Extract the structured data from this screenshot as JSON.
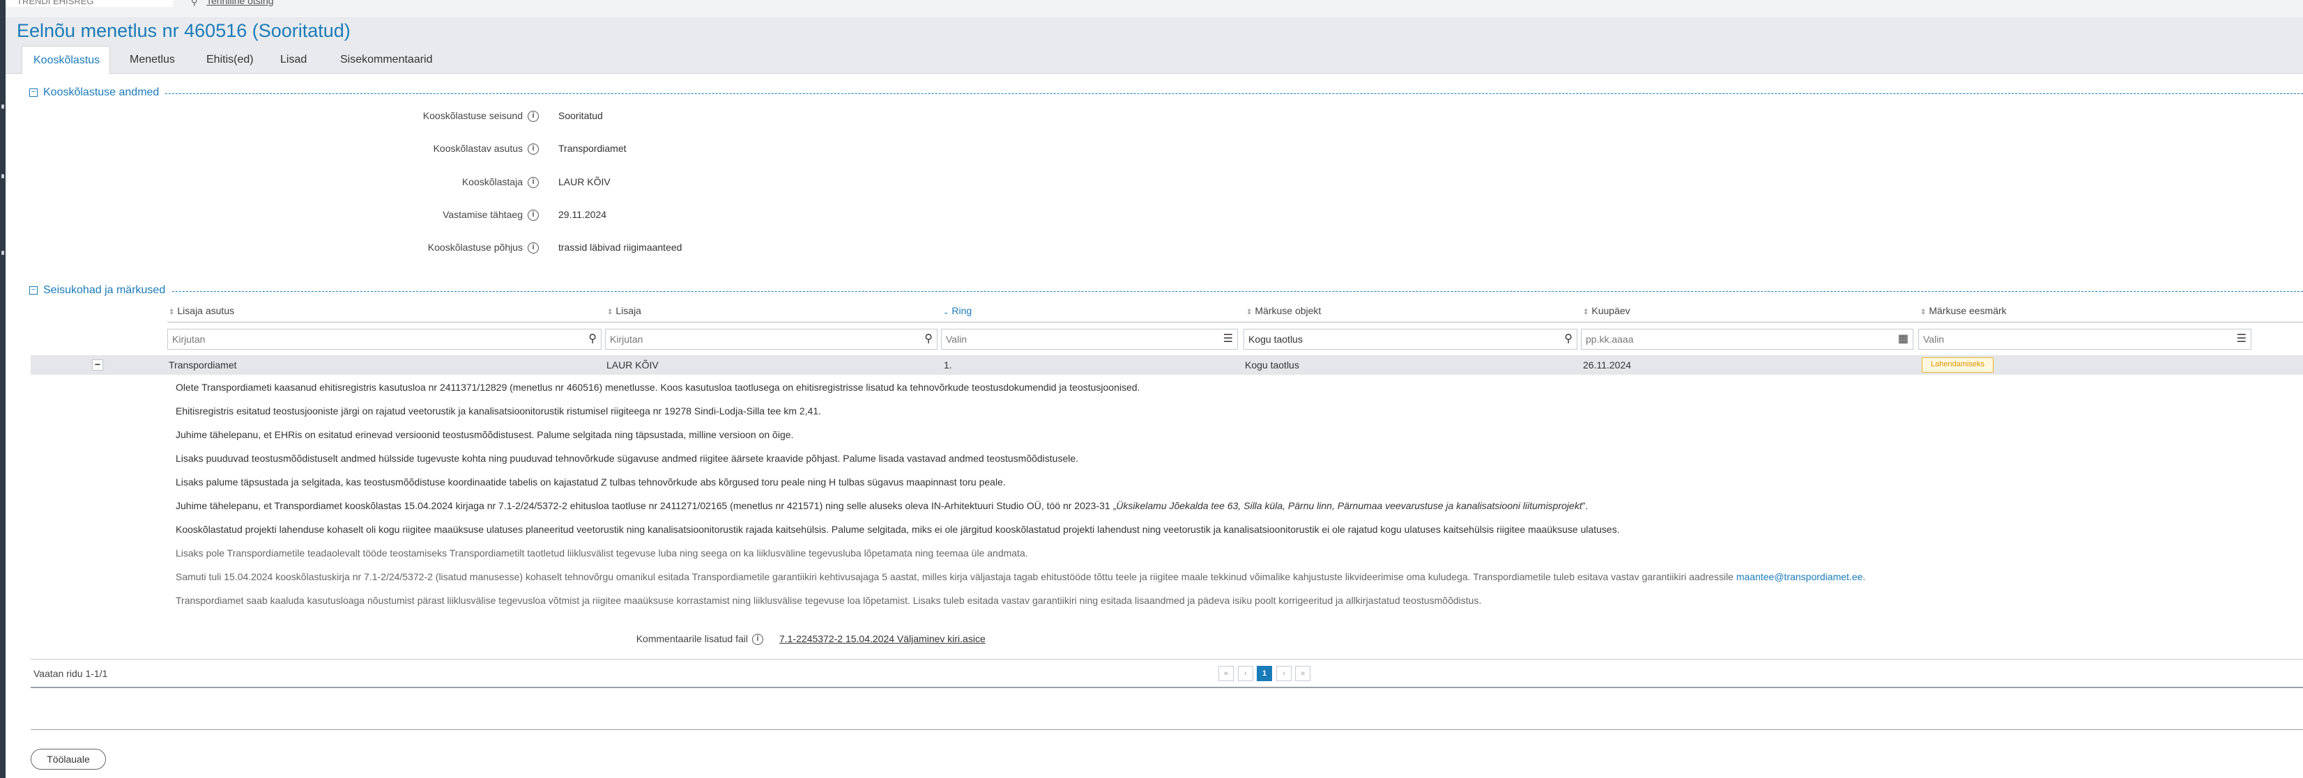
{
  "topbar": {
    "app_tab": "TRENDI EHISREG",
    "link": "Tehniline otsing"
  },
  "page": {
    "title": "Eelnõu menetlus nr 460516 (Sooritatud)"
  },
  "tabs": [
    "Kooskõlastus",
    "Menetlus",
    "Ehitis(ed)",
    "Lisad",
    "Sisekommentaarid"
  ],
  "sections": {
    "details": "Kooskõlastuse andmed",
    "remarks": "Seisukohad ja märkused"
  },
  "details": [
    {
      "label": "Kooskõlastuse seisund",
      "value": "Sooritatud"
    },
    {
      "label": "Kooskõlastav asutus",
      "value": "Transpordiamet"
    },
    {
      "label": "Kooskõlastaja",
      "value": "LAUR KÕIV"
    },
    {
      "label": "Vastamise tähtaeg",
      "value": "29.11.2024"
    },
    {
      "label": "Kooskõlastuse põhjus",
      "value": "trassid läbivad riigimaanteed"
    }
  ],
  "table": {
    "columns": [
      "Lisaja asutus",
      "Lisaja",
      "Ring",
      "Märkuse objekt",
      "Kuupäev",
      "Märkuse eesmärk"
    ],
    "filters": [
      "Kirjutan",
      "Kirjutan",
      "Valin",
      "Kogu taotlus",
      "pp.kk.aaaa",
      "Valin"
    ],
    "row": {
      "org": "Transpordiamet",
      "author": "LAUR KÕIV",
      "round": "1.",
      "object": "Kogu taotlus",
      "date": "26.11.2024",
      "purpose": "Lahendamiseks"
    },
    "remarks": [
      "Olete Transpordiameti kaasanud ehitisregistris kasutusloa nr 2411371/12829 (menetlus nr 460516) menetlusse. Koos kasutusloa taotlusega on ehitisregistrisse lisatud ka tehnovõrkude teostusdokumendid ja teostusjoonised.",
      "Ehitisregistris esitatud teostusjooniste järgi on rajatud veetorustik ja kanalisatsioonitorustik ristumisel riigiteega nr 19278 Sindi-Lodja-Silla tee km 2,41.",
      "Juhime tähelepanu, et EHRis on esitatud erinevad versioonid teostusmõõdistusest. Palume selgitada ning täpsustada, milline versioon on õige.",
      "Lisaks puuduvad teostusmõõdistuselt andmed hülsside tugevuste kohta ning puuduvad tehnovõrkude sügavuse andmed riigitee äärsete kraavide põhjast. Palume lisada vastavad andmed teostusmõõdistusele.",
      "Lisaks palume täpsustada ja selgitada, kas teostusmõõdistuse koordinaatide tabelis on kajastatud Z tulbas tehnovõrkude abs kõrgused toru peale ning H tulbas sügavus maapinnast toru peale.",
      "Juhime tähelepanu, et Transpordiamet kooskõlastas 15.04.2024 kirjaga nr 7.1-2/24/5372-2 ehitusloa taotluse nr 2411271/02165  (menetlus nr 421571) ning selle aluseks oleva IN-Arhitektuuri Studio OÜ, töö nr  2023-31 „",
      "Üksikelamu Jõekalda tee 63, Silla küla, Pärnu linn, Pärnumaa veevarustuse ja kanalisatsiooni liitumisprojekt",
      "”.",
      "Kooskõlastatud projekti lahenduse kohaselt oli kogu riigitee maaüksuse ulatuses planeeritud veetorustik ning kanalisatsioonitorustik rajada kaitsehülsis. Palume selgitada, miks ei ole järgitud kooskõlastatud projekti lahendust ning veetorustik ja kanalisatsioonitorustik ei ole rajatud kogu ulatuses kaitsehülsis riigitee maaüksuse ulatuses.",
      "Lisaks pole Transpordiametile teadaolevalt tööde teostamiseks Transpordiametilt taotletud liiklusvälist tegevuse luba ning seega on ka liiklusväline tegevusluba lõpetamata ning teemaa üle andmata.",
      "Samuti tuli 15.04.2024 kooskõlastuskirja nr 7.1-2/24/5372-2 (lisatud manusesse) kohaselt tehnovõrgu omanikul esitada Transpordiametile garantiikiri kehtivusajaga 5 aastat, milles kirja väljastaja tagab ehitustööde tõttu teele ja riigitee maale tekkinud võimalike kahjustuste likvideerimise oma kuludega. Transpordiametile tuleb esitava vastav garantiikiri aadressile ",
      "maantee@transpordiamet.ee",
      ".",
      "Transpordiamet saab kaaluda kasutusloaga nõustumist pärast liiklusvälise tegevusloa võtmist ja riigitee maaüksuse korrastamist ning liiklusvälise tegevuse loa lõpetamist. Lisaks tuleb esitada vastav garantiikiri ning esitada lisaandmed ja pädeva isiku poolt korrigeeritud ja allkirjastatud teostusmõõdistus."
    ],
    "attachment_label": "Kommentaarile lisatud fail",
    "attachment_file": "7.1-2245372-2 15.04.2024 Väljaminev kiri.asice"
  },
  "pagination": {
    "summary": "Vaatan ridu 1-1/1",
    "buttons": [
      "«",
      "‹",
      "1",
      "›",
      "»"
    ],
    "current": "1"
  },
  "actions": {
    "back": "Töölauale"
  },
  "colors": {
    "accent": "#1a7bb9",
    "badge": "#f0b429",
    "header_bg": "#e9eaed"
  },
  "icons": [
    "info-icon",
    "search-icon",
    "list-icon",
    "calendar-icon",
    "sort-icon",
    "collapse-icon"
  ]
}
